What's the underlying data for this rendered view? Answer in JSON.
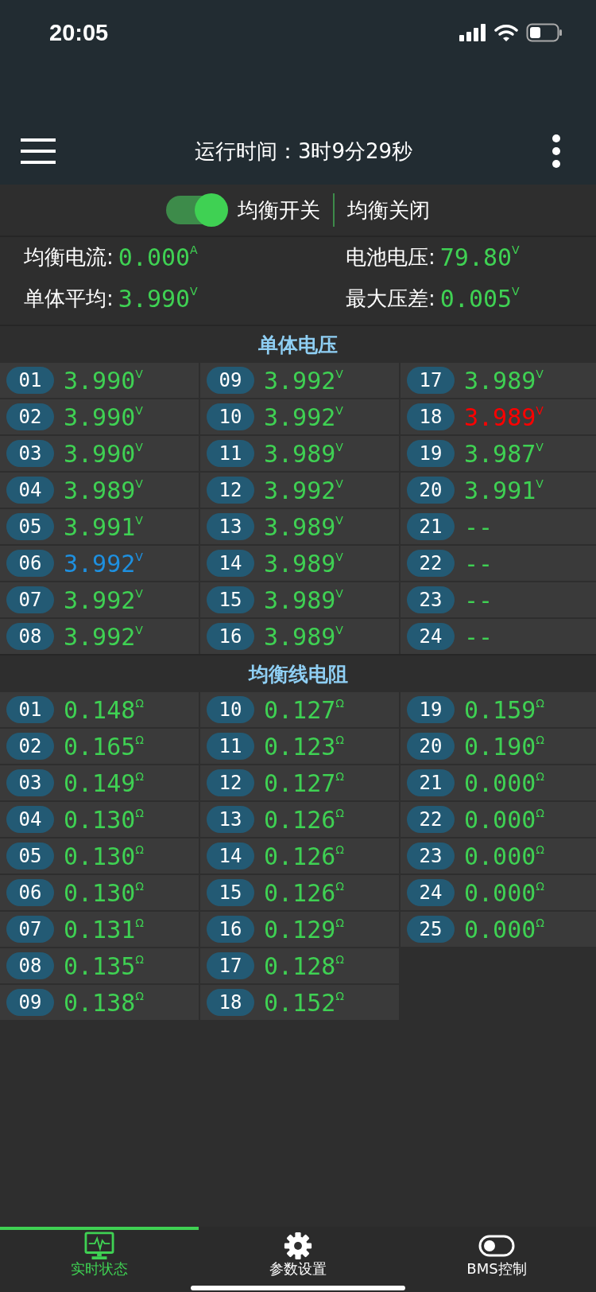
{
  "status_bar": {
    "time": "20:05"
  },
  "header": {
    "title": "运行时间：3时9分29秒"
  },
  "balance": {
    "switch_label": "均衡开关",
    "on": true,
    "state_text": "均衡关闭"
  },
  "stats": [
    {
      "label": "均衡电流:",
      "value": "0.000",
      "unit": "A"
    },
    {
      "label": "电池电压:",
      "value": "79.80",
      "unit": "V"
    },
    {
      "label": "单体平均:",
      "value": "3.990",
      "unit": "V"
    },
    {
      "label": "最大压差:",
      "value": "0.005",
      "unit": "V"
    }
  ],
  "sections": [
    {
      "title": "单体电压",
      "cells": [
        {
          "no": "01",
          "value": "3.990",
          "unit": "V",
          "color": "#3fd153"
        },
        {
          "no": "02",
          "value": "3.990",
          "unit": "V",
          "color": "#3fd153"
        },
        {
          "no": "03",
          "value": "3.990",
          "unit": "V",
          "color": "#3fd153"
        },
        {
          "no": "04",
          "value": "3.989",
          "unit": "V",
          "color": "#3fd153"
        },
        {
          "no": "05",
          "value": "3.991",
          "unit": "V",
          "color": "#3fd153"
        },
        {
          "no": "06",
          "value": "3.992",
          "unit": "V",
          "color": "#1e90e0"
        },
        {
          "no": "07",
          "value": "3.992",
          "unit": "V",
          "color": "#3fd153"
        },
        {
          "no": "08",
          "value": "3.992",
          "unit": "V",
          "color": "#3fd153"
        },
        {
          "no": "09",
          "value": "3.992",
          "unit": "V",
          "color": "#3fd153"
        },
        {
          "no": "10",
          "value": "3.992",
          "unit": "V",
          "color": "#3fd153"
        },
        {
          "no": "11",
          "value": "3.989",
          "unit": "V",
          "color": "#3fd153"
        },
        {
          "no": "12",
          "value": "3.992",
          "unit": "V",
          "color": "#3fd153"
        },
        {
          "no": "13",
          "value": "3.989",
          "unit": "V",
          "color": "#3fd153"
        },
        {
          "no": "14",
          "value": "3.989",
          "unit": "V",
          "color": "#3fd153"
        },
        {
          "no": "15",
          "value": "3.989",
          "unit": "V",
          "color": "#3fd153"
        },
        {
          "no": "16",
          "value": "3.989",
          "unit": "V",
          "color": "#3fd153"
        },
        {
          "no": "17",
          "value": "3.989",
          "unit": "V",
          "color": "#3fd153"
        },
        {
          "no": "18",
          "value": "3.989",
          "unit": "V",
          "color": "#ff0000"
        },
        {
          "no": "19",
          "value": "3.987",
          "unit": "V",
          "color": "#3fd153"
        },
        {
          "no": "20",
          "value": "3.991",
          "unit": "V",
          "color": "#3fd153"
        },
        {
          "no": "21",
          "value": "--",
          "color": "#3fd153"
        },
        {
          "no": "22",
          "value": "--",
          "color": "#3fd153"
        },
        {
          "no": "23",
          "value": "--",
          "color": "#3fd153"
        },
        {
          "no": "24",
          "value": "--",
          "color": "#3fd153"
        }
      ]
    },
    {
      "title": "均衡线电阻",
      "cells": [
        {
          "no": "01",
          "value": "0.148",
          "unit": "Ω",
          "color": "#3fd153"
        },
        {
          "no": "02",
          "value": "0.165",
          "unit": "Ω",
          "color": "#3fd153"
        },
        {
          "no": "03",
          "value": "0.149",
          "unit": "Ω",
          "color": "#3fd153"
        },
        {
          "no": "04",
          "value": "0.130",
          "unit": "Ω",
          "color": "#3fd153"
        },
        {
          "no": "05",
          "value": "0.130",
          "unit": "Ω",
          "color": "#3fd153"
        },
        {
          "no": "06",
          "value": "0.130",
          "unit": "Ω",
          "color": "#3fd153"
        },
        {
          "no": "07",
          "value": "0.131",
          "unit": "Ω",
          "color": "#3fd153"
        },
        {
          "no": "08",
          "value": "0.135",
          "unit": "Ω",
          "color": "#3fd153"
        },
        {
          "no": "09",
          "value": "0.138",
          "unit": "Ω",
          "color": "#3fd153"
        },
        {
          "no": "10",
          "value": "0.127",
          "unit": "Ω",
          "color": "#3fd153"
        },
        {
          "no": "11",
          "value": "0.123",
          "unit": "Ω",
          "color": "#3fd153"
        },
        {
          "no": "12",
          "value": "0.127",
          "unit": "Ω",
          "color": "#3fd153"
        },
        {
          "no": "13",
          "value": "0.126",
          "unit": "Ω",
          "color": "#3fd153"
        },
        {
          "no": "14",
          "value": "0.126",
          "unit": "Ω",
          "color": "#3fd153"
        },
        {
          "no": "15",
          "value": "0.126",
          "unit": "Ω",
          "color": "#3fd153"
        },
        {
          "no": "16",
          "value": "0.129",
          "unit": "Ω",
          "color": "#3fd153"
        },
        {
          "no": "17",
          "value": "0.128",
          "unit": "Ω",
          "color": "#3fd153"
        },
        {
          "no": "18",
          "value": "0.152",
          "unit": "Ω",
          "color": "#3fd153"
        },
        {
          "no": "19",
          "value": "0.159",
          "unit": "Ω",
          "color": "#3fd153"
        },
        {
          "no": "20",
          "value": "0.190",
          "unit": "Ω",
          "color": "#3fd153"
        },
        {
          "no": "21",
          "value": "0.000",
          "unit": "Ω",
          "color": "#3fd153"
        },
        {
          "no": "22",
          "value": "0.000",
          "unit": "Ω",
          "color": "#3fd153"
        },
        {
          "no": "23",
          "value": "0.000",
          "unit": "Ω",
          "color": "#3fd153"
        },
        {
          "no": "24",
          "value": "0.000",
          "unit": "Ω",
          "color": "#3fd153"
        },
        {
          "no": "25",
          "value": "0.000",
          "unit": "Ω",
          "color": "#3fd153"
        }
      ]
    }
  ],
  "tabs": [
    {
      "kind": "monitor",
      "label": "实时状态",
      "selected": true
    },
    {
      "kind": "gear",
      "label": "参数设置",
      "selected": false
    },
    {
      "kind": "toggle",
      "label": "BMS控制",
      "selected": false
    }
  ]
}
